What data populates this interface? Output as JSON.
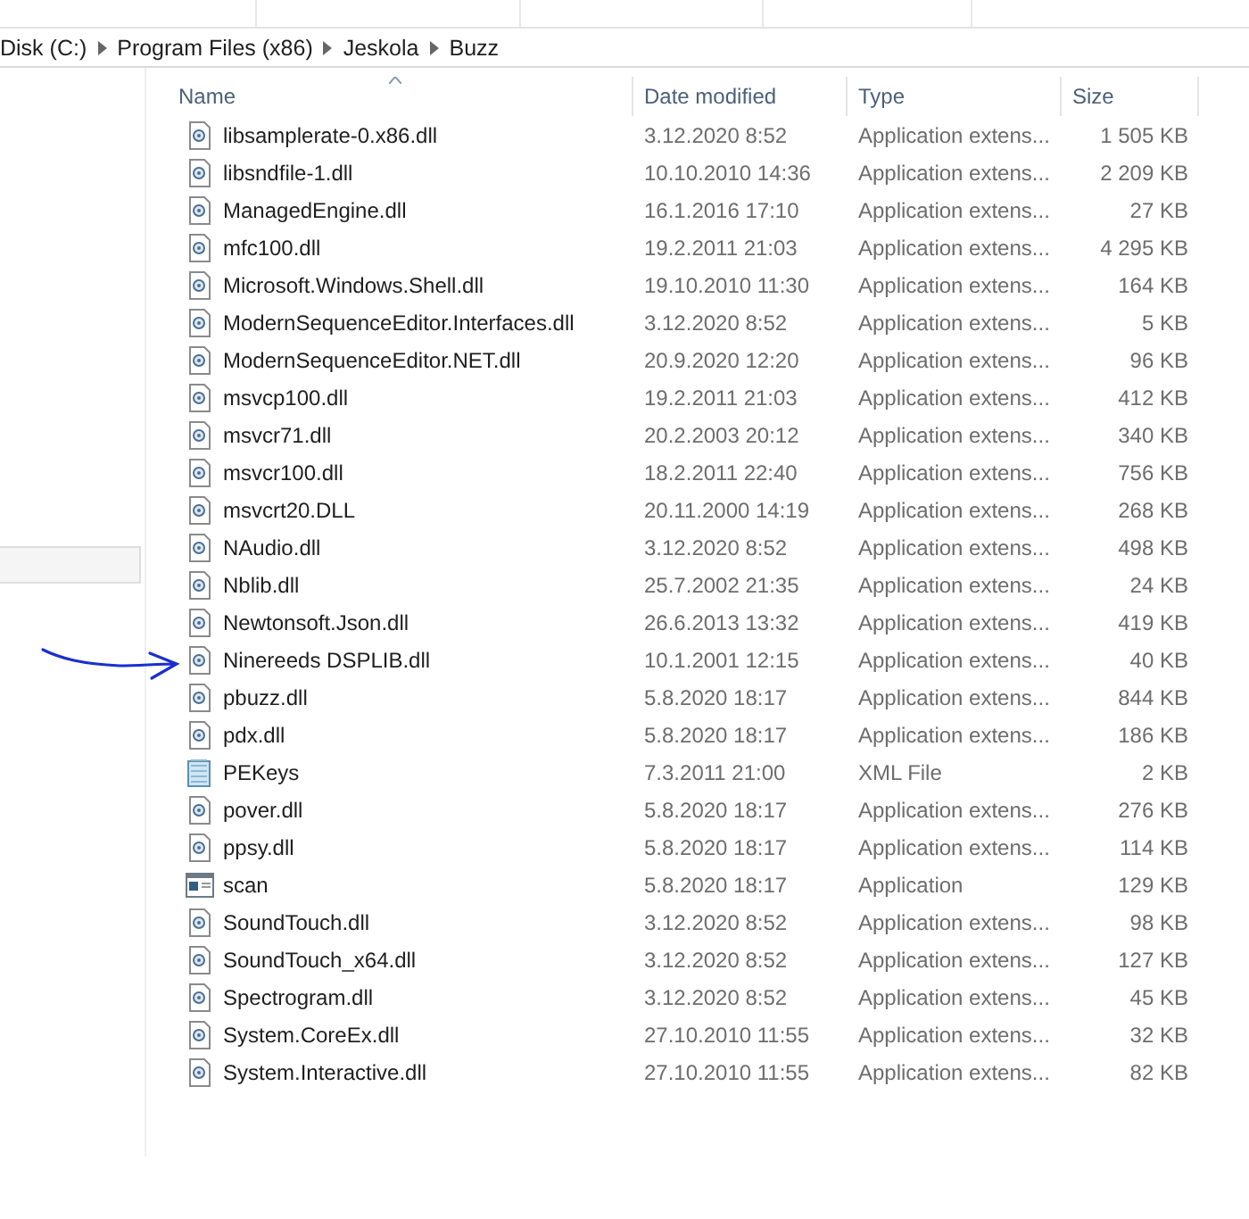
{
  "breadcrumb": [
    "Disk (C:)",
    "Program Files (x86)",
    "Jeskola",
    "Buzz"
  ],
  "columns": [
    {
      "label": "Name",
      "sorted": true
    },
    {
      "label": "Date modified",
      "sorted": false
    },
    {
      "label": "Type",
      "sorted": false
    },
    {
      "label": "Size",
      "sorted": false
    }
  ],
  "rows": [
    {
      "kind": "dll",
      "name": "libsamplerate-0.x86.dll",
      "date": "3.12.2020 8:52",
      "type": "Application extens...",
      "size": "1 505 KB"
    },
    {
      "kind": "dll",
      "name": "libsndfile-1.dll",
      "date": "10.10.2010 14:36",
      "type": "Application extens...",
      "size": "2 209 KB"
    },
    {
      "kind": "dll",
      "name": "ManagedEngine.dll",
      "date": "16.1.2016 17:10",
      "type": "Application extens...",
      "size": "27 KB"
    },
    {
      "kind": "dll",
      "name": "mfc100.dll",
      "date": "19.2.2011 21:03",
      "type": "Application extens...",
      "size": "4 295 KB"
    },
    {
      "kind": "dll",
      "name": "Microsoft.Windows.Shell.dll",
      "date": "19.10.2010 11:30",
      "type": "Application extens...",
      "size": "164 KB"
    },
    {
      "kind": "dll",
      "name": "ModernSequenceEditor.Interfaces.dll",
      "date": "3.12.2020 8:52",
      "type": "Application extens...",
      "size": "5 KB"
    },
    {
      "kind": "dll",
      "name": "ModernSequenceEditor.NET.dll",
      "date": "20.9.2020 12:20",
      "type": "Application extens...",
      "size": "96 KB"
    },
    {
      "kind": "dll",
      "name": "msvcp100.dll",
      "date": "19.2.2011 21:03",
      "type": "Application extens...",
      "size": "412 KB"
    },
    {
      "kind": "dll",
      "name": "msvcr71.dll",
      "date": "20.2.2003 20:12",
      "type": "Application extens...",
      "size": "340 KB"
    },
    {
      "kind": "dll",
      "name": "msvcr100.dll",
      "date": "18.2.2011 22:40",
      "type": "Application extens...",
      "size": "756 KB"
    },
    {
      "kind": "dll",
      "name": "msvcrt20.DLL",
      "date": "20.11.2000 14:19",
      "type": "Application extens...",
      "size": "268 KB"
    },
    {
      "kind": "dll",
      "name": "NAudio.dll",
      "date": "3.12.2020 8:52",
      "type": "Application extens...",
      "size": "498 KB"
    },
    {
      "kind": "dll",
      "name": "Nblib.dll",
      "date": "25.7.2002 21:35",
      "type": "Application extens...",
      "size": "24 KB"
    },
    {
      "kind": "dll",
      "name": "Newtonsoft.Json.dll",
      "date": "26.6.2013 13:32",
      "type": "Application extens...",
      "size": "419 KB"
    },
    {
      "kind": "dll",
      "name": "Ninereeds DSPLIB.dll",
      "date": "10.1.2001 12:15",
      "type": "Application extens...",
      "size": "40 KB"
    },
    {
      "kind": "dll",
      "name": "pbuzz.dll",
      "date": "5.8.2020 18:17",
      "type": "Application extens...",
      "size": "844 KB"
    },
    {
      "kind": "dll",
      "name": "pdx.dll",
      "date": "5.8.2020 18:17",
      "type": "Application extens...",
      "size": "186 KB"
    },
    {
      "kind": "xml",
      "name": "PEKeys",
      "date": "7.3.2011 21:00",
      "type": "XML File",
      "size": "2 KB"
    },
    {
      "kind": "dll",
      "name": "pover.dll",
      "date": "5.8.2020 18:17",
      "type": "Application extens...",
      "size": "276 KB"
    },
    {
      "kind": "dll",
      "name": "ppsy.dll",
      "date": "5.8.2020 18:17",
      "type": "Application extens...",
      "size": "114 KB"
    },
    {
      "kind": "app",
      "name": "scan",
      "date": "5.8.2020 18:17",
      "type": "Application",
      "size": "129 KB"
    },
    {
      "kind": "dll",
      "name": "SoundTouch.dll",
      "date": "3.12.2020 8:52",
      "type": "Application extens...",
      "size": "98 KB"
    },
    {
      "kind": "dll",
      "name": "SoundTouch_x64.dll",
      "date": "3.12.2020 8:52",
      "type": "Application extens...",
      "size": "127 KB"
    },
    {
      "kind": "dll",
      "name": "Spectrogram.dll",
      "date": "3.12.2020 8:52",
      "type": "Application extens...",
      "size": "45 KB"
    },
    {
      "kind": "dll",
      "name": "System.CoreEx.dll",
      "date": "27.10.2010 11:55",
      "type": "Application extens...",
      "size": "32 KB"
    },
    {
      "kind": "dll",
      "name": "System.Interactive.dll",
      "date": "27.10.2010 11:55",
      "type": "Application extens...",
      "size": "82 KB"
    }
  ]
}
